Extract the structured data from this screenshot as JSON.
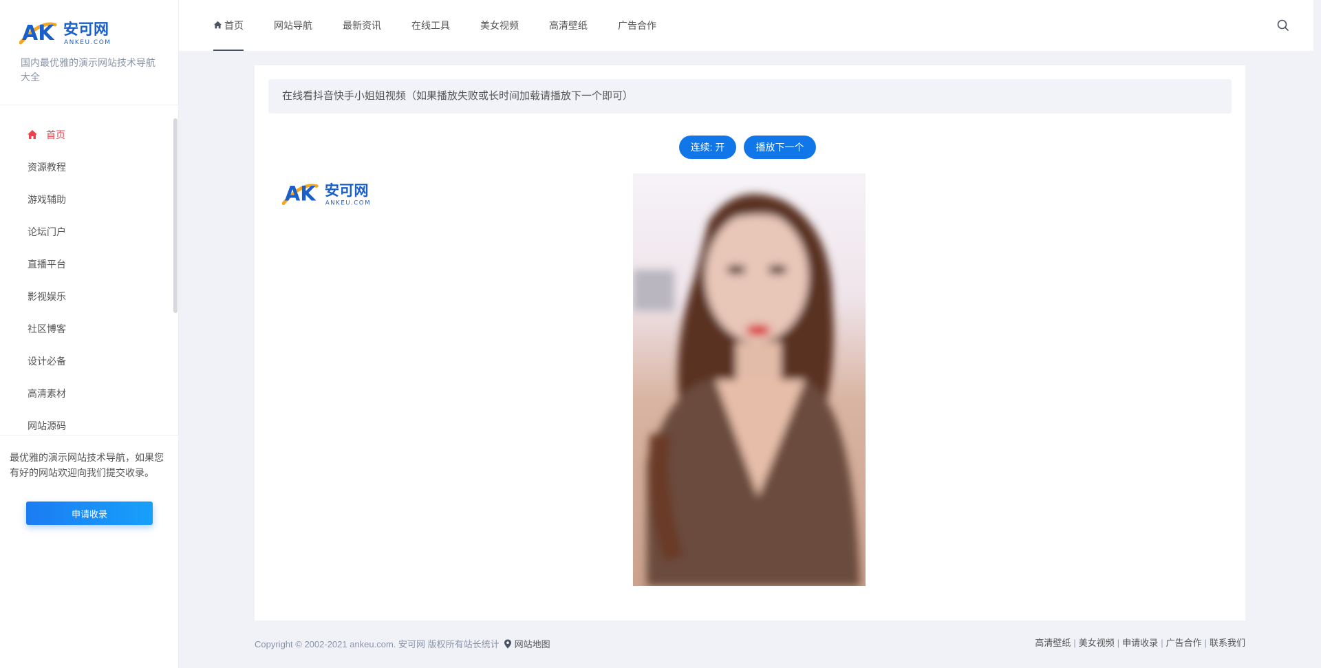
{
  "brand": {
    "logo_text": "安可网",
    "logo_sub": "ANKEU.COM",
    "logo_letters": "AK",
    "tagline": "国内最优雅的演示网站技术导航大全"
  },
  "sidebar": {
    "items": [
      {
        "label": "首页",
        "icon": "home-icon",
        "active": true
      },
      {
        "label": "资源教程"
      },
      {
        "label": "游戏辅助"
      },
      {
        "label": "论坛门户"
      },
      {
        "label": "直播平台"
      },
      {
        "label": "影视娱乐"
      },
      {
        "label": "社区博客"
      },
      {
        "label": "设计必备"
      },
      {
        "label": "高清素材"
      },
      {
        "label": "网站源码"
      }
    ],
    "note": "最优雅的演示网站技术导航，如果您有好的网站欢迎向我们提交收录。",
    "apply_label": "申请收录"
  },
  "topnav": {
    "items": [
      {
        "label": "首页",
        "icon": "home-icon",
        "active": true
      },
      {
        "label": "网站导航"
      },
      {
        "label": "最新资讯"
      },
      {
        "label": "在线工具"
      },
      {
        "label": "美女视频"
      },
      {
        "label": "高清壁纸"
      },
      {
        "label": "广告合作"
      }
    ],
    "search_icon": "search-icon"
  },
  "main": {
    "notice": "在线看抖音快手小姐姐视频（如果播放失败或长时间加载请播放下一个即可）",
    "continuous_label": "连续: 开",
    "next_label": "播放下一个"
  },
  "footer": {
    "copyright": "Copyright © 2002-2021 ankeu.com. 安可网 版权所有站长统计",
    "sitemap_label": "网站地图",
    "links": [
      "高清壁纸",
      "美女视频",
      "申请收录",
      "广告合作",
      "联系我们"
    ]
  },
  "colors": {
    "accent_red": "#f1404b",
    "button_blue": "#1177e8",
    "page_bg": "#f0f2f8",
    "logo_blue": "#1a5fc8",
    "logo_orange": "#f5a623"
  }
}
